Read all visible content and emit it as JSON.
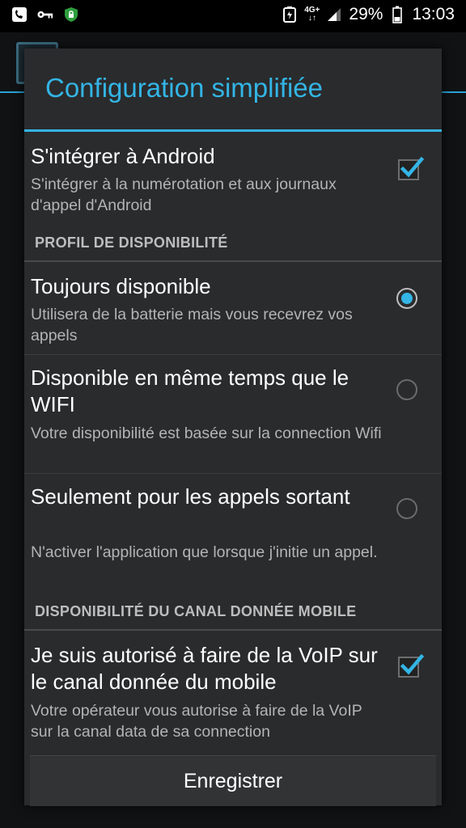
{
  "status_bar": {
    "battery": "29%",
    "time": "13:03",
    "network_top": "4G+",
    "network_bottom": "↓↑"
  },
  "dialog": {
    "title": "Configuration simplifiée",
    "items": [
      {
        "title": "S'intégrer à Android",
        "subtitle": "S'intégrer à la numérotation et aux journaux d'appel d'Android",
        "control": "checkbox",
        "checked": true
      }
    ],
    "sections": [
      {
        "header": "PROFIL DE DISPONIBILITÉ",
        "options": [
          {
            "title": "Toujours disponible",
            "subtitle": "Utilisera de la batterie mais vous recevrez vos appels",
            "selected": true
          },
          {
            "title": "Disponible en même temps que le WIFI",
            "subtitle": "Votre disponibilité est basée sur la connection Wifi",
            "selected": false
          },
          {
            "title": "Seulement pour les appels sortant",
            "subtitle": "N'activer l'application que lorsque j'initie un appel.",
            "selected": false
          }
        ]
      },
      {
        "header": "DISPONIBILITÉ DU CANAL DONNÉE MOBILE",
        "items": [
          {
            "title": "Je suis autorisé à faire de la VoIP sur le canal donnée du mobile",
            "subtitle": "Votre opérateur vous autorise à faire de la VoIP sur la canal data de sa connection",
            "checked": true
          }
        ]
      }
    ],
    "save_label": "Enregistrer"
  },
  "colors": {
    "accent": "#33b5e5",
    "dialog_bg": "#2a2b2d"
  }
}
